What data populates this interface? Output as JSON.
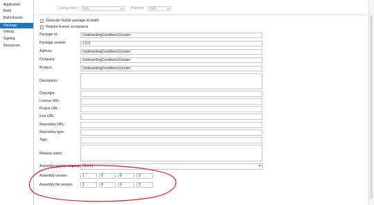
{
  "sidebar": {
    "items": [
      {
        "label": "Application",
        "active": false
      },
      {
        "label": "Build",
        "active": false
      },
      {
        "label": "Build Events",
        "active": false
      },
      {
        "label": "Package",
        "active": true
      },
      {
        "label": "Debug",
        "active": false
      },
      {
        "label": "Signing",
        "active": false
      },
      {
        "label": "Resources",
        "active": false
      }
    ]
  },
  "topbar": {
    "configuration_label": "Configuration:",
    "configuration_value": "N/A",
    "platform_label": "Platform:",
    "platform_value": "N/A"
  },
  "checkboxes": {
    "generate_nuget": "Generate NuGet package on build",
    "require_license": "Require license acceptance"
  },
  "fields": {
    "package_id": {
      "label": "Package id:",
      "value": "UnderwritingConditionsCounter"
    },
    "package_version": {
      "label": "Package version:",
      "value": "1.0.0"
    },
    "authors": {
      "label": "Authors:",
      "value": "UnderwritingConditionsCounter"
    },
    "company": {
      "label": "Company:",
      "value": "UnderwritingConditionsCounter"
    },
    "product": {
      "label": "Product:",
      "value": "UnderwritingConditionsCounter"
    },
    "description": {
      "label": "Description:",
      "value": ""
    },
    "copyright": {
      "label": "Copyright:",
      "value": ""
    },
    "license_url": {
      "label": "License URL:",
      "value": ""
    },
    "project_url": {
      "label": "Project URL:",
      "value": ""
    },
    "icon_url": {
      "label": "Icon URL:",
      "value": ""
    },
    "repository_url": {
      "label": "Repository URL:",
      "value": ""
    },
    "repository_type": {
      "label": "Repository type:",
      "value": ""
    },
    "tags": {
      "label": "Tags:",
      "value": ""
    },
    "release_notes": {
      "label": "Release notes:",
      "value": ""
    },
    "neutral_language": {
      "label": "Assembly neutral language:",
      "value": "(None)"
    }
  },
  "assembly_version": {
    "label": "Assembly version:",
    "parts": [
      "1",
      "0",
      "0",
      "3"
    ]
  },
  "file_version": {
    "label": "Assembly file version:",
    "parts": [
      "1",
      "0",
      "0",
      "3"
    ]
  },
  "colors": {
    "accent": "#1f73c5",
    "annotation": "#d0201f"
  }
}
